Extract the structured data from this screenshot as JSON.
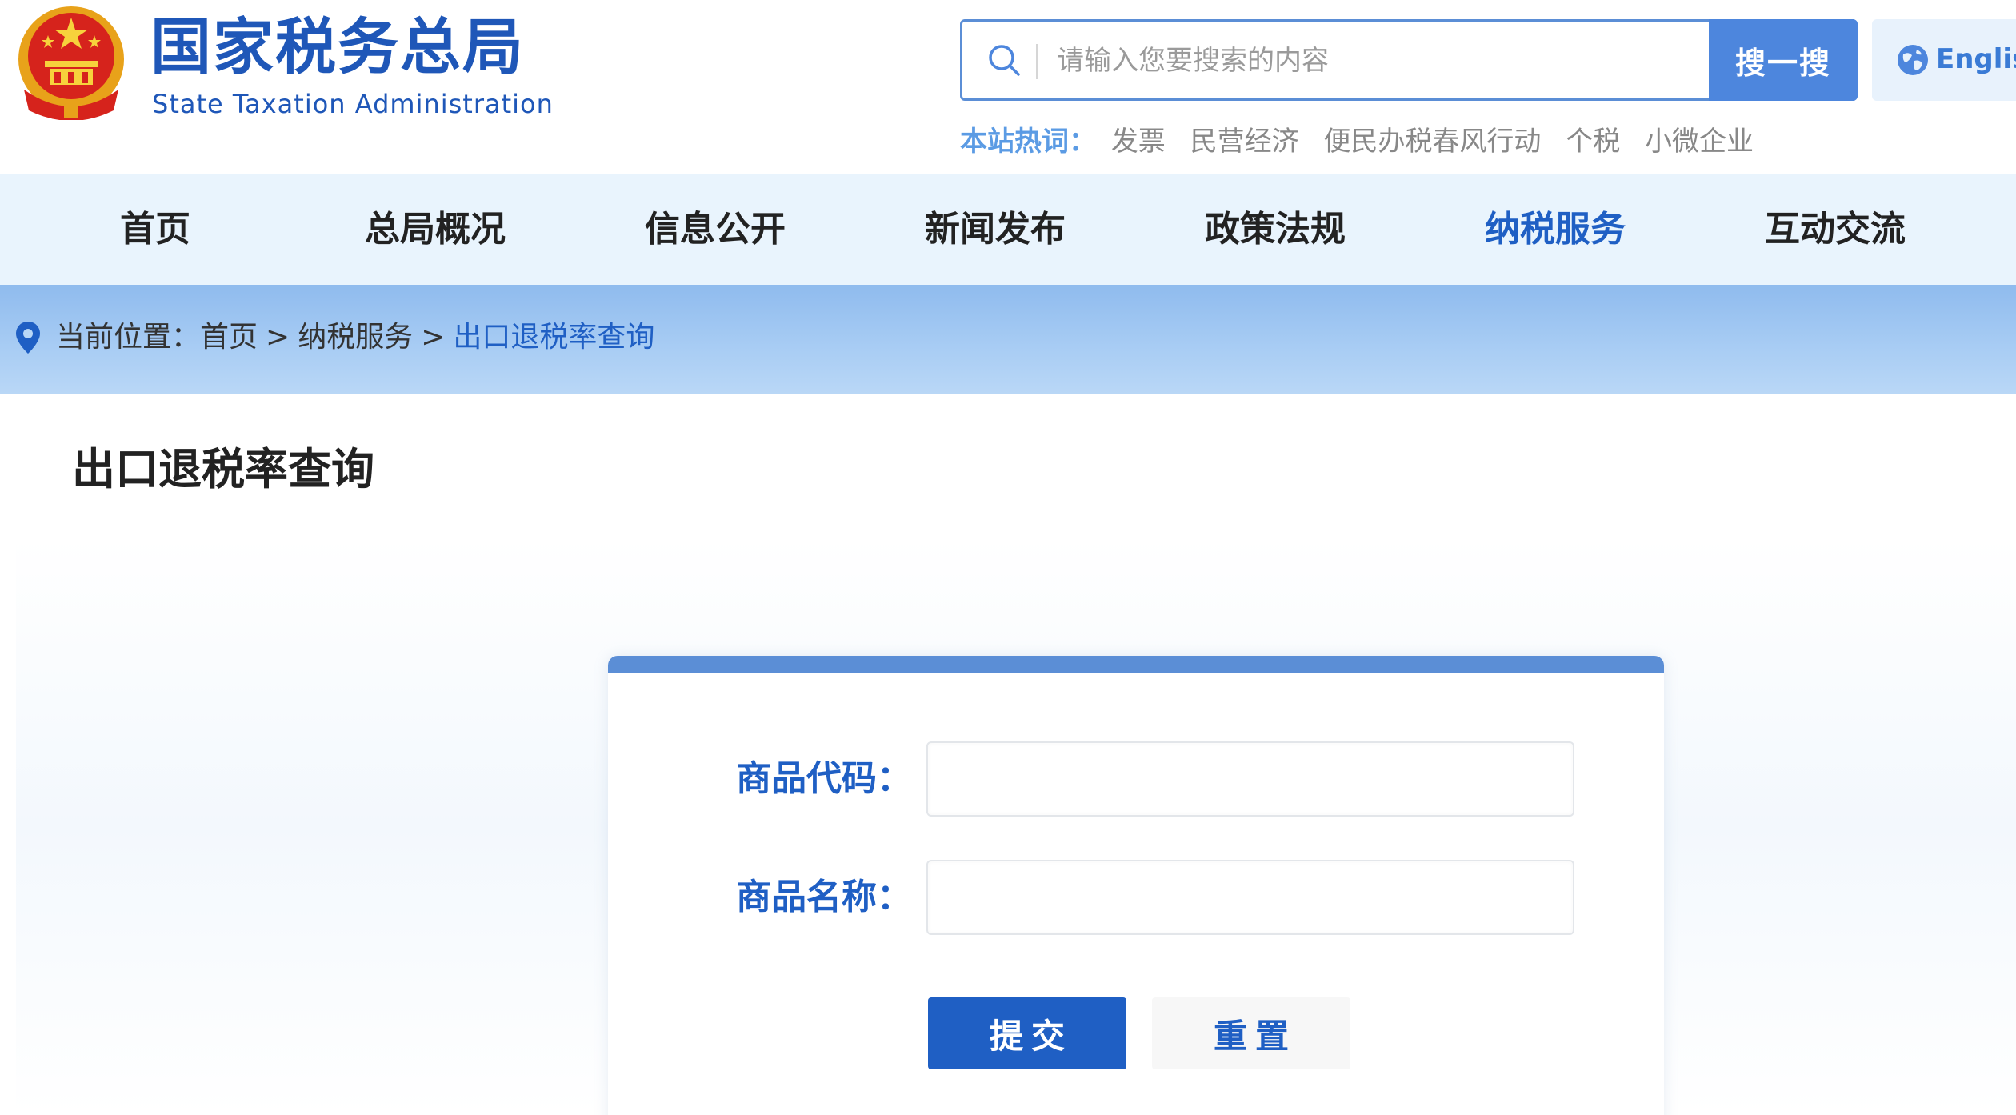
{
  "header": {
    "site_title": "国家税务总局",
    "site_subtitle": "State Taxation Administration",
    "logo_icon": "national-emblem-icon",
    "search": {
      "placeholder": "请输入您要搜索的内容",
      "button_label": "搜一搜",
      "icon": "search-icon"
    },
    "english_label": "English",
    "english_icon": "globe-icon",
    "hot_words_label": "本站热词：",
    "hot_words": [
      "发票",
      "民营经济",
      "便民办税春风行动",
      "个税",
      "小微企业"
    ]
  },
  "nav": {
    "items": [
      {
        "label": "首页"
      },
      {
        "label": "总局概况"
      },
      {
        "label": "信息公开"
      },
      {
        "label": "新闻发布"
      },
      {
        "label": "政策法规"
      },
      {
        "label": "纳税服务",
        "active": true
      },
      {
        "label": "互动交流"
      }
    ]
  },
  "breadcrumb": {
    "icon": "location-pin-icon",
    "prefix": "当前位置：",
    "items": [
      "首页",
      "纳税服务",
      "出口退税率查询"
    ],
    "separator": ">"
  },
  "main": {
    "page_title": "出口退税率查询",
    "form": {
      "product_code_label": "商品代码：",
      "product_code_value": "",
      "product_name_label": "商品名称：",
      "product_name_value": "",
      "submit_label": "提交",
      "reset_label": "重置"
    }
  },
  "colors": {
    "brand_blue": "#1f5fc4",
    "accent_blue": "#5b8ed6",
    "nav_bg": "#e9f4fd",
    "active_nav": "#1f5fc4",
    "hot_label": "#5b9be4"
  }
}
